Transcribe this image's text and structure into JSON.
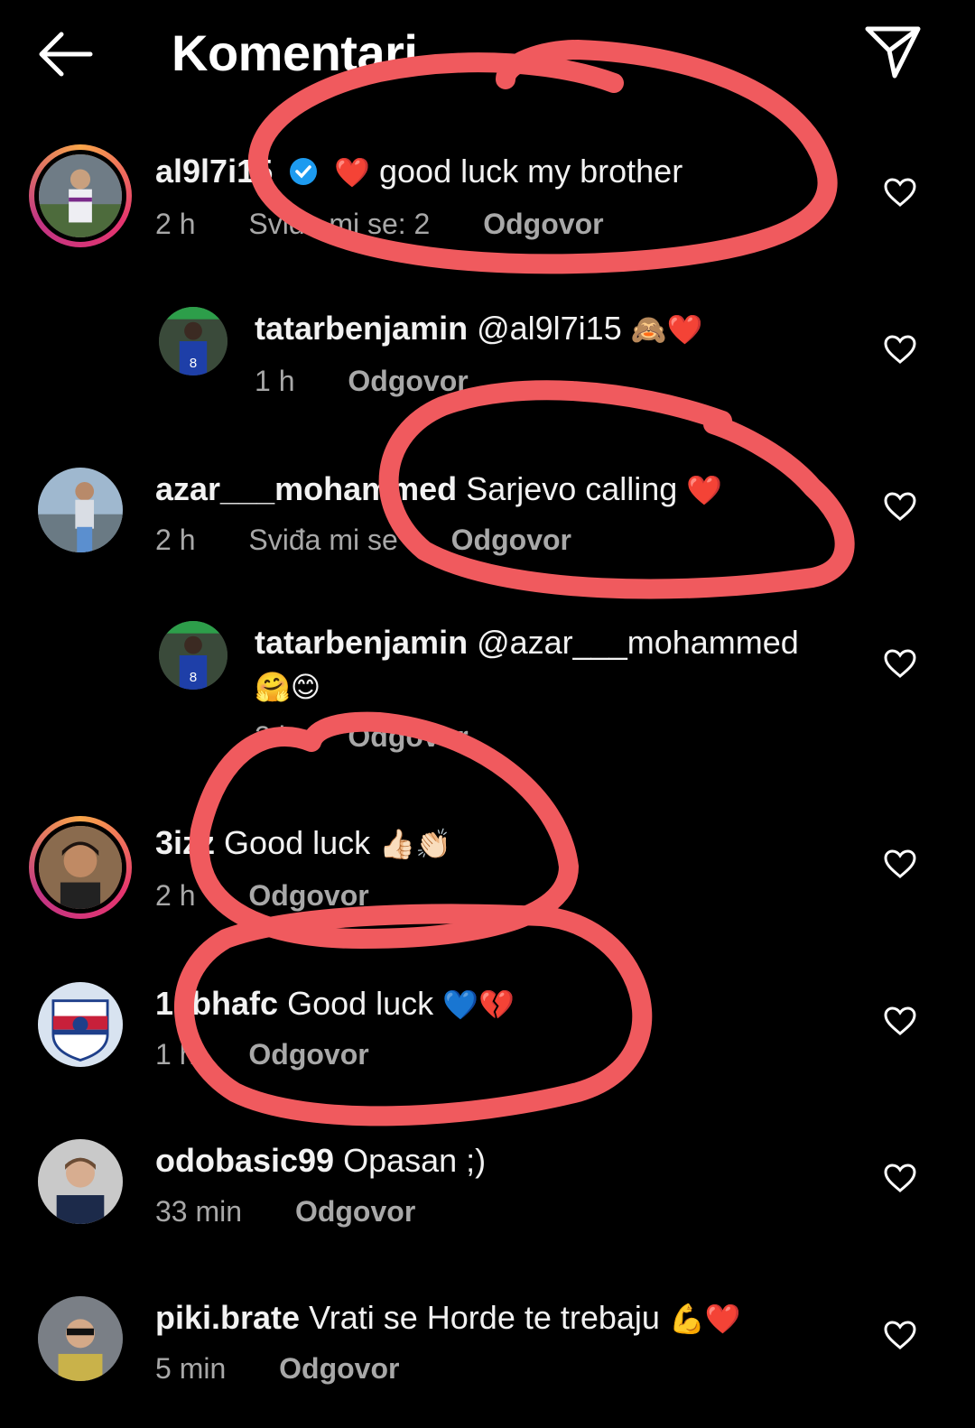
{
  "header": {
    "title": "Komentari"
  },
  "colors": {
    "background": "#000000",
    "text": "#f2f2f2",
    "meta": "#a8a8a8",
    "annotation": "#f05a5e",
    "verified": "#1d9bf0"
  },
  "comments": [
    {
      "username": "al9l7i15",
      "verified": true,
      "text_emoji": "❤️",
      "text": "good luck my brother",
      "time": "2 h",
      "likes": "Sviđa mi se: 2",
      "reply": "Odgovor"
    },
    {
      "username": "tatarbenjamin",
      "text": "@al9l7i15",
      "emoji": "🙈❤️",
      "time": "1 h",
      "reply": "Odgovor"
    },
    {
      "username": "azar___mohammed",
      "text": "Sarjevo calling",
      "emoji": "❤️",
      "time": "2 h",
      "likes": "Sviđa mi se",
      "reply": "Odgovor"
    },
    {
      "username": "tatarbenjamin",
      "text": "@azar___mohammed",
      "emoji": "🤗😊",
      "time": "2 h",
      "reply": "Odgovor"
    },
    {
      "username": "3izz",
      "text": "Good luck",
      "emoji": "👍🏻👏🏻",
      "time": "2 h",
      "reply": "Odgovor"
    },
    {
      "username": "1abhafc",
      "text": "Good luck",
      "emoji": "💙💔",
      "time": "1 h",
      "reply": "Odgovor"
    },
    {
      "username": "odobasic99",
      "text": "Opasan ;)",
      "time": "33 min",
      "reply": "Odgovor"
    },
    {
      "username": "piki.brate",
      "text": "Vrati se Horde te trebaju",
      "emoji": "💪❤️",
      "time": "5 min",
      "reply": "Odgovor"
    }
  ]
}
